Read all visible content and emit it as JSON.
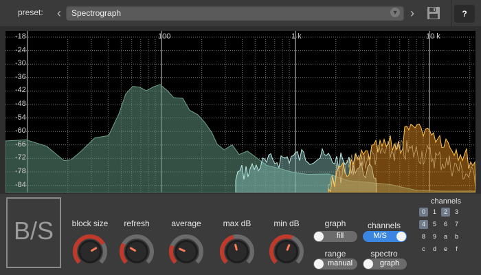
{
  "header": {
    "preset_label": "preset:",
    "preset_value": "Spectrograph",
    "help_label": "?"
  },
  "graph": {
    "y_labels": [
      "-18",
      "-24",
      "-30",
      "-36",
      "-42",
      "-48",
      "-54",
      "-60",
      "-66",
      "-72",
      "-78",
      "-84"
    ],
    "x_labels": [
      "100",
      "1 k",
      "10 k"
    ]
  },
  "logo": {
    "text": "B/S"
  },
  "knobs": [
    {
      "label": "block size",
      "value": 0.72
    },
    {
      "label": "refresh",
      "value": 0.28
    },
    {
      "label": "average",
      "value": 0.25
    },
    {
      "label": "max dB",
      "value": 0.45
    },
    {
      "label": "min dB",
      "value": 0.58
    }
  ],
  "toggles": {
    "graph": {
      "label": "graph",
      "value": "fill",
      "on": false
    },
    "channels": {
      "label": "channels",
      "value": "M/S",
      "on": true
    },
    "range": {
      "label": "range",
      "value": "manual",
      "on": false
    },
    "spectro": {
      "label": "spectro",
      "value": "graph",
      "on": false
    }
  },
  "channels_grid": {
    "label": "channels",
    "items": [
      {
        "label": "0",
        "active": true
      },
      {
        "label": "1",
        "active": false
      },
      {
        "label": "2",
        "active": true
      },
      {
        "label": "3",
        "active": false
      },
      {
        "label": "4",
        "active": true
      },
      {
        "label": "5",
        "active": false
      },
      {
        "label": "6",
        "active": false
      },
      {
        "label": "7",
        "active": false
      },
      {
        "label": "8",
        "active": false
      },
      {
        "label": "9",
        "active": false
      },
      {
        "label": "a",
        "active": false
      },
      {
        "label": "b",
        "active": false
      },
      {
        "label": "c",
        "active": false
      },
      {
        "label": "d",
        "active": false
      },
      {
        "label": "e",
        "active": false
      },
      {
        "label": "f",
        "active": false
      }
    ]
  },
  "colors": {
    "spectrum_mid": "#5f8f7a",
    "spectrum_side": "#e08a1f",
    "side_outline": "#ffc44d",
    "mid_outline": "#b9ece6",
    "toggle_on": "#3b86e0"
  },
  "icons": {
    "prev": "chevron-left-icon",
    "next": "chevron-right-icon",
    "save": "save-icon",
    "caret": "chevron-down-icon"
  }
}
